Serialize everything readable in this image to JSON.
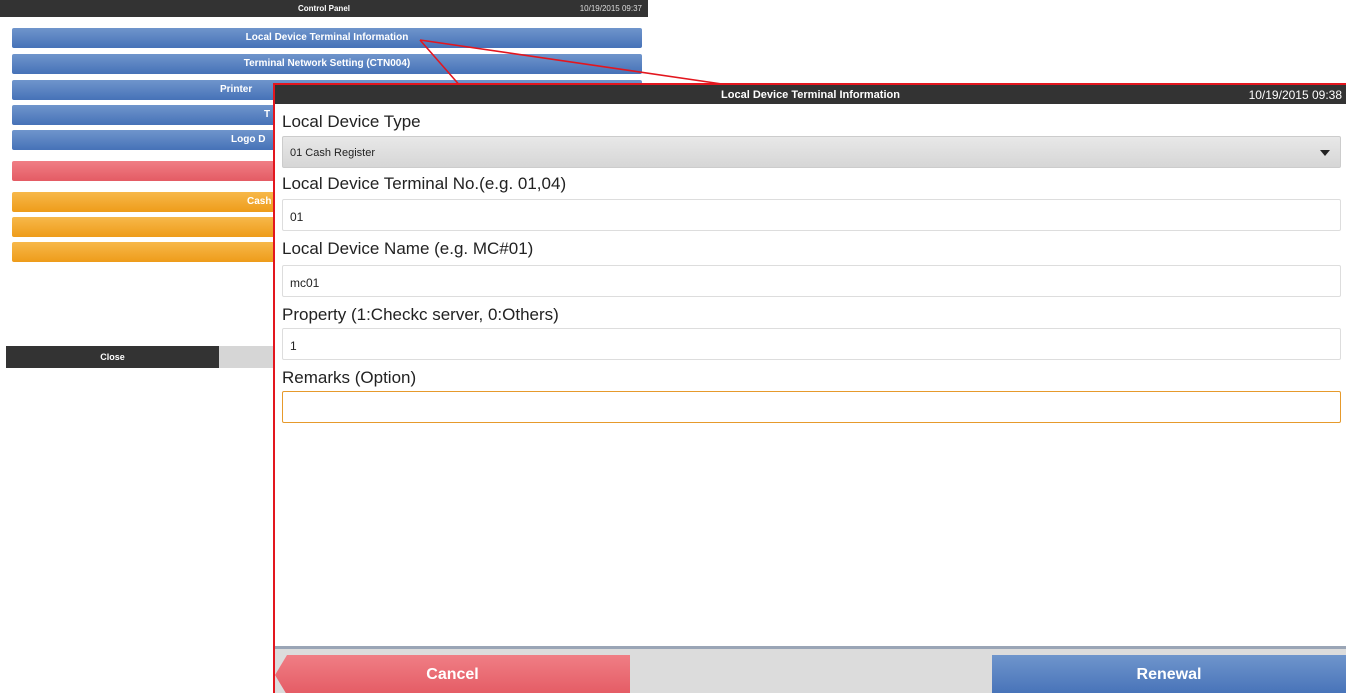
{
  "control_panel": {
    "title": "Control Panel",
    "timestamp": "10/19/2015 09:37",
    "buttons": [
      {
        "label": "Local Device Terminal Information",
        "color": "blue"
      },
      {
        "label": "Terminal Network Setting (CTN004)",
        "color": "blue"
      },
      {
        "label": "Printer",
        "color": "blue"
      },
      {
        "label": "T",
        "color": "blue"
      },
      {
        "label": "Logo D",
        "color": "blue"
      },
      {
        "label": "",
        "color": "red"
      },
      {
        "label": "Cash",
        "color": "orange"
      },
      {
        "label": "",
        "color": "orange"
      },
      {
        "label": "",
        "color": "orange"
      }
    ],
    "close_label": "Close"
  },
  "dialog": {
    "title": "Local Device Terminal Information",
    "timestamp": "10/19/2015 09:38",
    "device_type": {
      "label": "Local Device Type",
      "value": "01 Cash Register"
    },
    "terminal_no": {
      "label": "Local Device Terminal No.(e.g. 01,04)",
      "value": "01"
    },
    "device_name": {
      "label": "Local Device Name (e.g. MC#01)",
      "value": "mc01"
    },
    "property": {
      "label": "Property (1:Checkc server, 0:Others)",
      "value": "1"
    },
    "remarks": {
      "label": "Remarks (Option)",
      "value": ""
    },
    "cancel_label": "Cancel",
    "renewal_label": "Renewal"
  },
  "colors": {
    "accent_blue": "#4672b8",
    "cancel_red": "#e45b64",
    "highlight_red": "#e3161e",
    "focus_orange": "#e69a2c"
  }
}
